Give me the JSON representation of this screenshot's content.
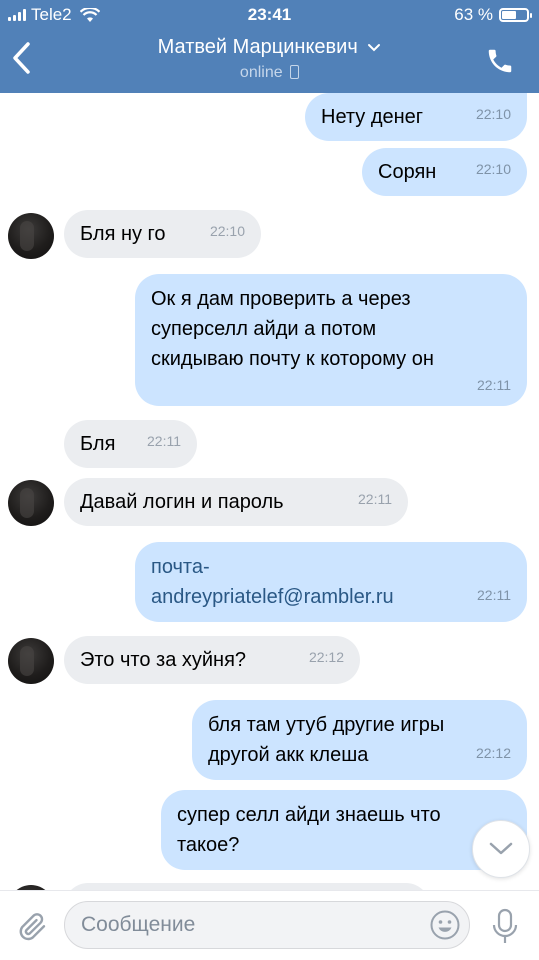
{
  "status_bar": {
    "carrier": "Tele2",
    "time": "23:41",
    "battery": "63 %",
    "battery_level": 0.63
  },
  "header": {
    "contact_name": "Матвей Марцинкевич",
    "status": "online",
    "icons": {
      "back": "chevron-left-icon",
      "call": "phone-icon",
      "dropdown": "chevron-down-icon",
      "device": "mobile-icon"
    }
  },
  "messages": [
    {
      "dir": "out",
      "text": "Нету денег",
      "time": "22:10"
    },
    {
      "dir": "out",
      "text": "Сорян",
      "time": "22:10"
    },
    {
      "dir": "in",
      "text": "Бля ну го",
      "time": "22:10"
    },
    {
      "dir": "out",
      "text": "Ок я дам проверить а через\nсуперселл айди а потом\nскидываю почту к которому он",
      "time": "22:11"
    },
    {
      "dir": "in",
      "text": "Бля",
      "time": "22:11"
    },
    {
      "dir": "in",
      "text": "Давай логин и пароль",
      "time": "22:11"
    },
    {
      "dir": "out",
      "text": "почта-\nandreypriatelef@rambler.ru",
      "time": "22:11"
    },
    {
      "dir": "in",
      "text": "Это что за хуйня?",
      "time": "22:12"
    },
    {
      "dir": "out",
      "text": "бля там утуб другие игры\nдругой акк клеша",
      "time": "22:12"
    },
    {
      "dir": "out",
      "text": "супер селл айди знаешь что\nтакое?",
      "time": ""
    }
  ],
  "composer": {
    "placeholder": "Сообщение",
    "value": "",
    "icons": {
      "attach": "paperclip-icon",
      "emoji": "smile-icon",
      "mic": "microphone-icon",
      "scroll_down": "chevron-down-icon"
    }
  },
  "colors": {
    "header_bg": "#5181b8",
    "outgoing_bubble": "#cce4ff",
    "incoming_bubble": "#ebedf0",
    "link": "#2a5885"
  }
}
